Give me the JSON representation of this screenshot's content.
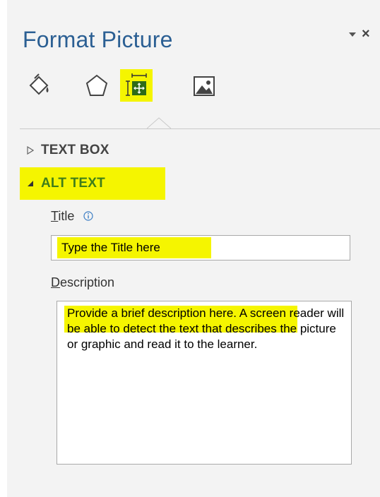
{
  "pane": {
    "title": "Format Picture",
    "options_icon": "dropdown-arrow-icon",
    "close_icon": "close-icon",
    "close_glyph": "×"
  },
  "tabs": [
    {
      "name": "fill-line-tab",
      "icon": "paint-bucket-icon",
      "active": false
    },
    {
      "name": "effects-tab",
      "icon": "pentagon-icon",
      "active": false
    },
    {
      "name": "size-properties-tab",
      "icon": "size-properties-icon",
      "active": true
    },
    {
      "name": "picture-tab",
      "icon": "picture-icon",
      "active": false
    }
  ],
  "sections": {
    "text_box": {
      "label": "TEXT BOX",
      "expanded": false
    },
    "alt_text": {
      "label": "ALT TEXT",
      "expanded": true
    }
  },
  "fields": {
    "title": {
      "label_mnemonic": "T",
      "label_rest": "itle",
      "value": "Type the Title here"
    },
    "description": {
      "label_mnemonic": "D",
      "label_rest": "escription",
      "value": "Provide a brief description here. A screen reader will be able to detect the text that describes the picture or graphic and read it to the learner."
    }
  },
  "colors": {
    "title": "#2b5f93",
    "highlight": "#f5f500",
    "alt_text_header": "#3f7e1a",
    "pane_background": "#f3f3f3"
  }
}
